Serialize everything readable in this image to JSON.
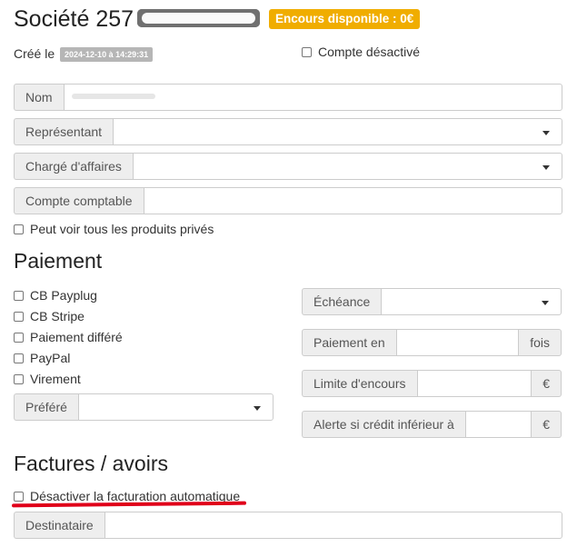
{
  "header": {
    "title": "Société 257",
    "credit_badge": "Encours disponible : 0€",
    "created_label": "Créé le",
    "created_date": "2024-12-10 à 14:29:31",
    "deactivated_label": "Compte désactivé"
  },
  "fields": {
    "nom_label": "Nom",
    "representant_label": "Représentant",
    "charge_label": "Chargé d'affaires",
    "compte_comptable_label": "Compte comptable",
    "private_products_label": "Peut voir tous les produits privés"
  },
  "paiement": {
    "heading": "Paiement",
    "methods": [
      "CB Payplug",
      "CB Stripe",
      "Paiement différé",
      "PayPal",
      "Virement"
    ],
    "prefere_label": "Préféré",
    "echeance_label": "Échéance",
    "paiement_en_label": "Paiement en",
    "fois_label": "fois",
    "limite_label": "Limite d'encours",
    "alerte_label": "Alerte si crédit inférieur à",
    "currency": "€"
  },
  "factures": {
    "heading": "Factures / avoirs",
    "disable_auto_label": "Désactiver la facturation automatique",
    "destinataire_label": "Destinataire"
  },
  "colors": {
    "accent_orange": "#f0ad00",
    "annotation_red": "#e0001a"
  }
}
